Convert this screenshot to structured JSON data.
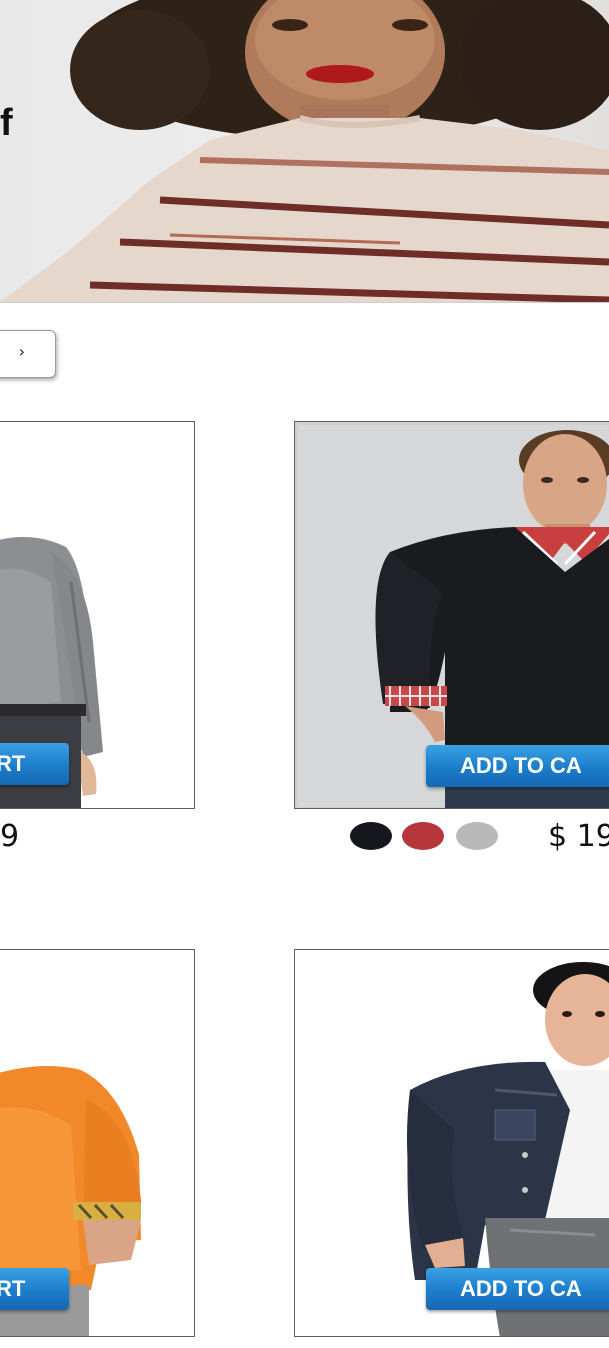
{
  "hero": {
    "headline": "f"
  },
  "sort_dropdown": {
    "icon": "chevron-down-icon",
    "glyph": "›"
  },
  "products": [
    {
      "id": "grey-shirt",
      "button_label": "RT",
      "price": "9",
      "colors": []
    },
    {
      "id": "black-sweater",
      "button_label": "ADD TO CA",
      "price": "$ 19",
      "colors": [
        "#15171c",
        "#b5373c",
        "#b8b8b8"
      ]
    },
    {
      "id": "orange-sweater",
      "button_label": "RT",
      "price": "",
      "colors": []
    },
    {
      "id": "denim-jacket",
      "button_label": "ADD TO CA",
      "price": "",
      "colors": []
    }
  ],
  "colors": {
    "button_blue": "#1c7dcb",
    "swatch_black": "#15171c",
    "swatch_red": "#b5373c",
    "swatch_grey": "#b8b8b8"
  }
}
